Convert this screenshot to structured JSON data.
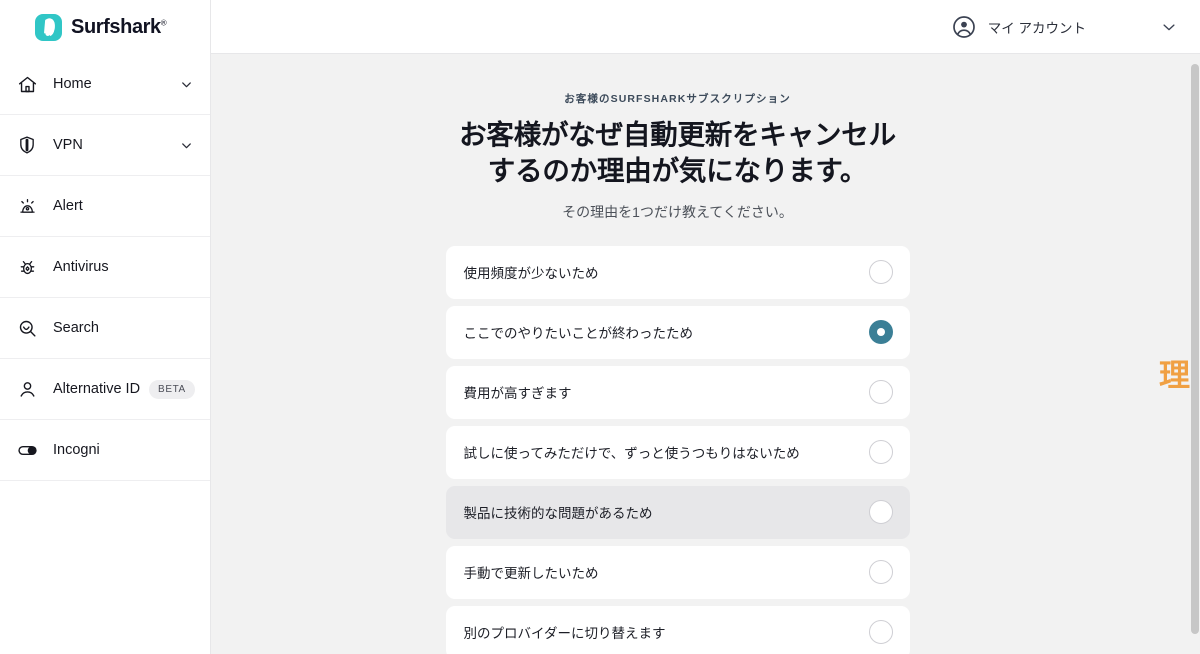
{
  "brand": {
    "name": "Surfshark",
    "registered": "®",
    "logo_icon": "surfshark-logo-icon"
  },
  "sidebar": {
    "items": [
      {
        "label": "Home",
        "icon": "home-icon",
        "chevron": true,
        "badge": null
      },
      {
        "label": "VPN",
        "icon": "shield-icon",
        "chevron": true,
        "badge": null
      },
      {
        "label": "Alert",
        "icon": "alert-siren-icon",
        "chevron": false,
        "badge": null
      },
      {
        "label": "Antivirus",
        "icon": "bug-icon",
        "chevron": false,
        "badge": null
      },
      {
        "label": "Search",
        "icon": "search-magnifier-icon",
        "chevron": false,
        "badge": null
      },
      {
        "label": "Alternative ID",
        "icon": "person-icon",
        "chevron": false,
        "badge": "BETA"
      },
      {
        "label": "Incogni",
        "icon": "toggle-icon",
        "chevron": false,
        "badge": null
      }
    ]
  },
  "topbar": {
    "account_label": "マイ アカウント",
    "avatar_icon": "account-circle-icon",
    "chevron_icon": "chevron-down-icon"
  },
  "main": {
    "eyebrow": "お客様のSURFSHARKサブスクリプション",
    "headline": "お客様がなぜ自動更新をキャンセルするのか理由が気になります。",
    "subhead": "その理由を1つだけ教えてください。",
    "options": [
      {
        "label": "使用頻度が少ないため",
        "selected": false,
        "hovered": false
      },
      {
        "label": "ここでのやりたいことが終わったため",
        "selected": true,
        "hovered": false
      },
      {
        "label": "費用が高すぎます",
        "selected": false,
        "hovered": false
      },
      {
        "label": "試しに使ってみただけで、ずっと使うつもりはないため",
        "selected": false,
        "hovered": false
      },
      {
        "label": "製品に技術的な問題があるため",
        "selected": false,
        "hovered": true
      },
      {
        "label": "手動で更新したいため",
        "selected": false,
        "hovered": false
      },
      {
        "label": "別のプロバイダーに切り替えます",
        "selected": false,
        "hovered": false
      }
    ]
  },
  "annotation": {
    "text": "理由を選択",
    "color": "#f0a043"
  },
  "colors": {
    "brand_teal": "#30c6c6",
    "selected_radio": "#3b7f96",
    "page_background": "#f2f2f2",
    "card_background": "#ffffff",
    "hover_background": "#e7e7e9",
    "annotation_orange": "#f0a043"
  }
}
